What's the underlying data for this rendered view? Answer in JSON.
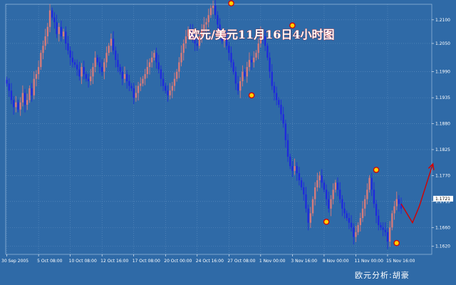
{
  "chart_data": {
    "type": "candlestick",
    "title": "欧元/美元11月16日4小时图",
    "credit": "欧元分析:胡豪",
    "ylim": [
      1.1603,
      1.2133
    ],
    "y_ticks": [
      1.21,
      1.205,
      1.199,
      1.1935,
      1.188,
      1.1825,
      1.177,
      1.1715,
      1.166,
      1.162
    ],
    "y_tick_labels": [
      "1.2100",
      "1.2050",
      "1.1990",
      "1.1935",
      "1.1880",
      "1.1825",
      "1.1770",
      "1.1715",
      "1.1660",
      "1.1620"
    ],
    "current_price": "1.1721",
    "x_ticks": [
      {
        "label": "30 Sep 2005",
        "index": 0
      },
      {
        "label": "5 Oct 08:00",
        "index": 14
      },
      {
        "label": "10 Oct 08:00",
        "index": 28
      },
      {
        "label": "12 Oct 16:00",
        "index": 42
      },
      {
        "label": "17 Oct 08:00",
        "index": 56
      },
      {
        "label": "20 Oct 00:00",
        "index": 70
      },
      {
        "label": "24 Oct 16:00",
        "index": 84
      },
      {
        "label": "27 Oct 08:00",
        "index": 98
      },
      {
        "label": "1 Nov 00:00",
        "index": 112
      },
      {
        "label": "3 Nov 16:00",
        "index": 126
      },
      {
        "label": "8 Nov 00:00",
        "index": 140
      },
      {
        "label": "11 Nov 00:00",
        "index": 154
      },
      {
        "label": "15 Nov 16:00",
        "index": 168
      }
    ],
    "closes": [
      1.1965,
      1.195,
      1.193,
      1.1915,
      1.1925,
      1.191,
      1.1925,
      1.1945,
      1.192,
      1.193,
      1.1955,
      1.194,
      1.1975,
      1.1985,
      1.2,
      1.203,
      1.2045,
      1.2065,
      1.2085,
      1.212,
      1.2105,
      1.2095,
      1.207,
      1.2085,
      1.2065,
      1.2075,
      1.205,
      1.2035,
      1.202,
      1.201,
      1.2005,
      1.1995,
      1.198,
      1.2,
      1.1985,
      1.1975,
      1.197,
      1.198,
      1.2,
      1.202,
      1.201,
      1.2,
      1.199,
      1.201,
      1.203,
      1.2045,
      1.206,
      1.2035,
      1.2015,
      1.2,
      1.199,
      1.1975,
      1.1985,
      1.197,
      1.196,
      1.1955,
      1.1935,
      1.1945,
      1.196,
      1.1965,
      1.1975,
      1.1985,
      1.2,
      1.201,
      1.202,
      1.203,
      1.201,
      1.1995,
      1.1975,
      1.196,
      1.195,
      1.194,
      1.195,
      1.196,
      1.1975,
      1.199,
      1.201,
      1.203,
      1.205,
      1.2065,
      1.208,
      1.2075,
      1.206,
      1.205,
      1.2045,
      1.2065,
      1.208,
      1.209,
      1.2095,
      1.211,
      1.2125,
      1.213,
      1.211,
      1.209,
      1.207,
      1.2055,
      1.206,
      1.2045,
      1.203,
      1.201,
      1.199,
      1.1965,
      1.195,
      1.197,
      1.199,
      1.198,
      1.2,
      1.2015,
      1.201,
      1.202,
      1.203,
      1.205,
      1.207,
      1.2065,
      1.2045,
      1.202,
      1.199,
      1.196,
      1.1945,
      1.193,
      1.192,
      1.19,
      1.188,
      1.1845,
      1.181,
      1.179,
      1.178,
      1.179,
      1.1775,
      1.176,
      1.1745,
      1.173,
      1.17,
      1.167,
      1.169,
      1.172,
      1.1745,
      1.176,
      1.177,
      1.1755,
      1.174,
      1.172,
      1.17,
      1.172,
      1.174,
      1.1755,
      1.174,
      1.172,
      1.17,
      1.169,
      1.168,
      1.167,
      1.166,
      1.164,
      1.165,
      1.1665,
      1.168,
      1.17,
      1.172,
      1.174,
      1.1765,
      1.174,
      1.171,
      1.1685,
      1.1665,
      1.166,
      1.1655,
      1.165,
      1.163,
      1.166,
      1.169,
      1.1705,
      1.172,
      1.171,
      1.17
    ],
    "markers": [
      {
        "index": 99,
        "price": 1.2135
      },
      {
        "index": 108,
        "price": 1.194
      },
      {
        "index": 126,
        "price": 1.2088
      },
      {
        "index": 141,
        "price": 1.1672
      },
      {
        "index": 163,
        "price": 1.1782
      },
      {
        "index": 172,
        "price": 1.1627
      }
    ],
    "projection": [
      {
        "index": 174,
        "price": 1.171
      },
      {
        "index": 179,
        "price": 1.167
      },
      {
        "index": 182,
        "price": 1.1705
      },
      {
        "index": 188,
        "price": 1.1795
      }
    ],
    "colors": {
      "background": "#2f6aa7",
      "grid": "#5f8fc0",
      "up_candle": "#d67b7b",
      "down_candle": "#1f2bdc",
      "marker_fill": "#ffd200",
      "marker_stroke": "#d40000",
      "projection": "#d40000",
      "title_fill": "#ffffff",
      "title_outline": "#c00000"
    }
  }
}
